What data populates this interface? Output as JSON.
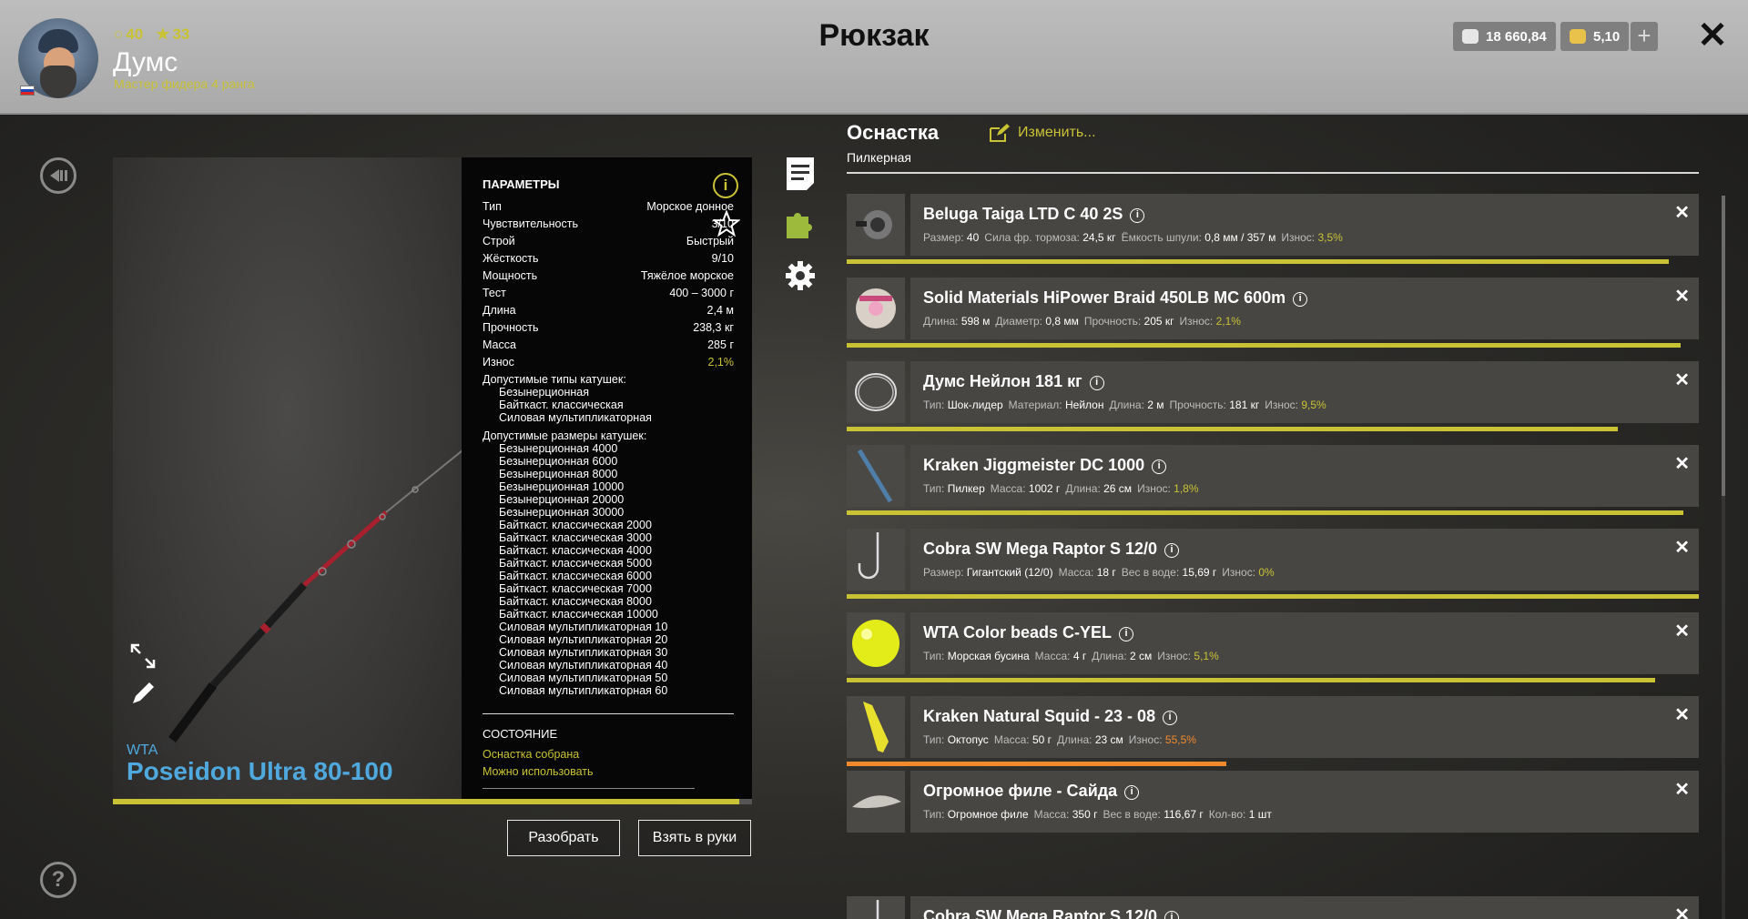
{
  "header": {
    "level_icon": "ring-icon",
    "level": "40",
    "star_icon": "star-icon",
    "stars": "33",
    "player_name": "Думс",
    "player_rank": "Мастер фидера 4 ранга",
    "title": "Рюкзак",
    "silver": "18 660,84",
    "gold": "5,10",
    "plus": "+",
    "close": "✕"
  },
  "rod": {
    "brand": "WTA",
    "name": "Poseidon Ultra 80-100",
    "condition": 0.98
  },
  "params": {
    "heading": "ПАРАМЕТРЫ",
    "rows": [
      {
        "k": "Тип",
        "v": "Морское донное"
      },
      {
        "k": "Чувствительность",
        "v": "3/10"
      },
      {
        "k": "Строй",
        "v": "Быстрый"
      },
      {
        "k": "Жёсткость",
        "v": "9/10"
      },
      {
        "k": "Мощность",
        "v": "Тяжёлое морское"
      },
      {
        "k": "Тест",
        "v": "400 – 3000 г"
      },
      {
        "k": "Длина",
        "v": "2,4 м"
      },
      {
        "k": "Прочность",
        "v": "238,3 кг"
      },
      {
        "k": "Масса",
        "v": "285 г"
      },
      {
        "k": "Износ",
        "v": "2,1%"
      }
    ],
    "reel_types_heading": "Допустимые типы катушек:",
    "reel_types": [
      "Безынерционная",
      "Байткаст. классическая",
      "Силовая мультипликаторная"
    ],
    "reel_sizes_heading": "Допустимые размеры катушек:",
    "reel_sizes": [
      "Безынерционная 4000",
      "Безынерционная 6000",
      "Безынерционная 8000",
      "Безынерционная 10000",
      "Безынерционная 20000",
      "Безынерционная 30000",
      "Байткаст. классическая 2000",
      "Байткаст. классическая 3000",
      "Байткаст. классическая 4000",
      "Байткаст. классическая 5000",
      "Байткаст. классическая 6000",
      "Байткаст. классическая 7000",
      "Байткаст. классическая 8000",
      "Байткаст. классическая 10000",
      "Силовая мультипликаторная 10",
      "Силовая мультипликаторная 20",
      "Силовая мультипликаторная 30",
      "Силовая мультипликаторная 40",
      "Силовая мультипликаторная 50",
      "Силовая мультипликаторная 60"
    ],
    "state_heading": "СОСТОЯНИЕ",
    "state_lines": [
      "Оснастка собрана",
      "Можно использовать"
    ]
  },
  "buttons": {
    "disassemble": "Разобрать",
    "take": "Взять в руки"
  },
  "tackle": {
    "title": "Оснастка",
    "edit": "Изменить...",
    "subtitle": "Пилкерная",
    "items": [
      {
        "name": "Beluga Taiga LTD C 40 2S",
        "thumb": "reel",
        "props": [
          [
            "Размер:",
            "40"
          ],
          [
            "Сила фр. тормоза:",
            "24,5 кг"
          ],
          [
            "Ёмкость шпули:",
            "0,8 мм / 357 м"
          ]
        ],
        "wear_label": "Износ:",
        "wear": "3,5%",
        "wear_red": false,
        "bar": 0.965,
        "bar_color": "#c9c235"
      },
      {
        "name": "Solid Materials HiPower Braid 450LB MC 600m",
        "thumb": "line",
        "props": [
          [
            "Длина:",
            "598 м"
          ],
          [
            "Диаметр:",
            "0,8 мм"
          ],
          [
            "Прочность:",
            "205 кг"
          ]
        ],
        "wear_label": "Износ:",
        "wear": "2,1%",
        "wear_red": false,
        "bar": 0.979,
        "bar_color": "#c9c235"
      },
      {
        "name": "Думс Нейлон 181 кг",
        "thumb": "leader",
        "props": [
          [
            "Тип:",
            "Шок-лидер"
          ],
          [
            "Материал:",
            "Нейлон"
          ],
          [
            "Длина:",
            "2 м"
          ],
          [
            "Прочность:",
            "181 кг"
          ]
        ],
        "wear_label": "Износ:",
        "wear": "9,5%",
        "wear_red": false,
        "bar": 0.905,
        "bar_color": "#c9c235"
      },
      {
        "name": "Kraken Jiggmeister DC 1000",
        "thumb": "jig",
        "props": [
          [
            "Тип:",
            "Пилкер"
          ],
          [
            "Масса:",
            "1002 г"
          ],
          [
            "Длина:",
            "26 см"
          ]
        ],
        "wear_label": "Износ:",
        "wear": "1,8%",
        "wear_red": false,
        "bar": 0.982,
        "bar_color": "#c9c235"
      },
      {
        "name": "Cobra SW Mega Raptor S 12/0",
        "thumb": "hook",
        "props": [
          [
            "Размер:",
            "Гигантский (12/0)"
          ],
          [
            "Масса:",
            "18 г"
          ],
          [
            "Вес в воде:",
            "15,69 г"
          ]
        ],
        "wear_label": "Износ:",
        "wear": "0%",
        "wear_red": false,
        "bar": 1.0,
        "bar_color": "#c9c235"
      },
      {
        "name": "WTA Color beads C-YEL",
        "thumb": "bead",
        "props": [
          [
            "Тип:",
            "Морская бусина"
          ],
          [
            "Масса:",
            "4 г"
          ],
          [
            "Длина:",
            "2 см"
          ]
        ],
        "wear_label": "Износ:",
        "wear": "5,1%",
        "wear_red": false,
        "bar": 0.949,
        "bar_color": "#c9c235"
      },
      {
        "name": "Kraken Natural Squid - 23 - 08",
        "thumb": "squid",
        "props": [
          [
            "Тип:",
            "Октопус"
          ],
          [
            "Масса:",
            "50 г"
          ],
          [
            "Длина:",
            "23 см"
          ]
        ],
        "wear_label": "Износ:",
        "wear": "55,5%",
        "wear_red": true,
        "bar": 0.445,
        "bar_color": "#f08a2c"
      },
      {
        "name": "Огромное филе - Сайда",
        "thumb": "fillet",
        "props": [
          [
            "Тип:",
            "Огромное филе"
          ],
          [
            "Масса:",
            "350 г"
          ],
          [
            "Вес в воде:",
            "116,67 г"
          ],
          [
            "Кол-во:",
            "1 шт"
          ]
        ],
        "wear_label": "",
        "wear": "",
        "wear_red": false,
        "bar": null,
        "bar_color": "#c9c235"
      },
      {
        "name": "Cobra SW Mega Raptor S 12/0",
        "thumb": "hook",
        "props": [],
        "wear_label": "",
        "wear": "",
        "wear_red": false,
        "bar": null,
        "bar_color": "#c9c235"
      }
    ]
  },
  "colors": {
    "accent": "#c9c235",
    "rod_name": "#4fa9de",
    "wear_high": "#f08a2c"
  }
}
